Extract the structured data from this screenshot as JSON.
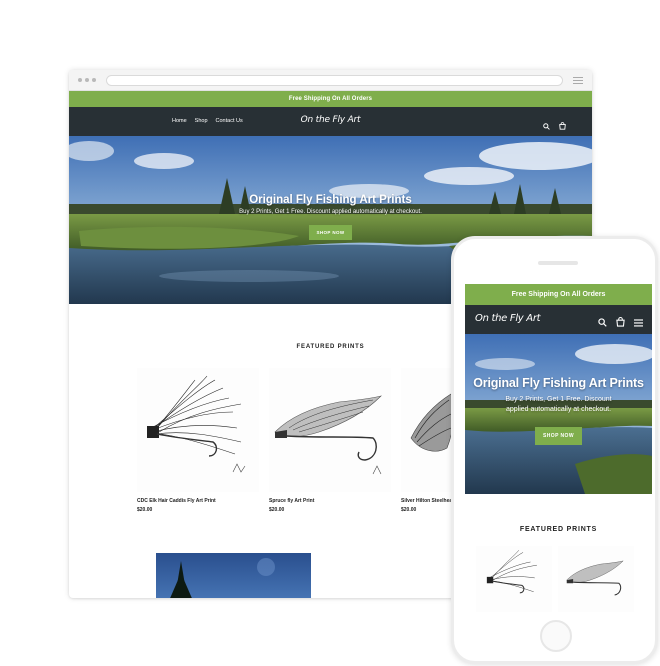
{
  "desktop": {
    "announcement": "Free Shipping On All Orders",
    "nav": [
      "Home",
      "Shop",
      "Contact Us"
    ],
    "brand": "On the Fly Art",
    "hero": {
      "title": "Original Fly Fishing Art Prints",
      "subtitle": "Buy 2 Prints, Get 1 Free. Discount applied automatically at checkout.",
      "button": "SHOP NOW"
    },
    "featured_title": "FEATURED PRINTS",
    "products": [
      {
        "name": "CDC Elk Hair Caddis Fly Art Print",
        "price": "$20.00"
      },
      {
        "name": "Spruce fly Art Print",
        "price": "$20.00"
      },
      {
        "name": "Silver Hilton Steelhead",
        "price": "$20.00"
      }
    ]
  },
  "mobile": {
    "announcement": "Free Shipping On All Orders",
    "brand": "On the Fly Art",
    "hero": {
      "title": "Original Fly Fishing Art Prints",
      "subtitle": "Buy 2 Prints, Get 1 Free. Discount applied automatically at checkout.",
      "button": "SHOP NOW"
    },
    "featured_title": "FEATURED PRINTS"
  },
  "icons": {
    "search": "search-icon",
    "cart": "cart-icon",
    "menu": "hamburger-menu-icon"
  },
  "colors": {
    "accent_green": "#7fae4c",
    "header_dark": "#283035"
  }
}
